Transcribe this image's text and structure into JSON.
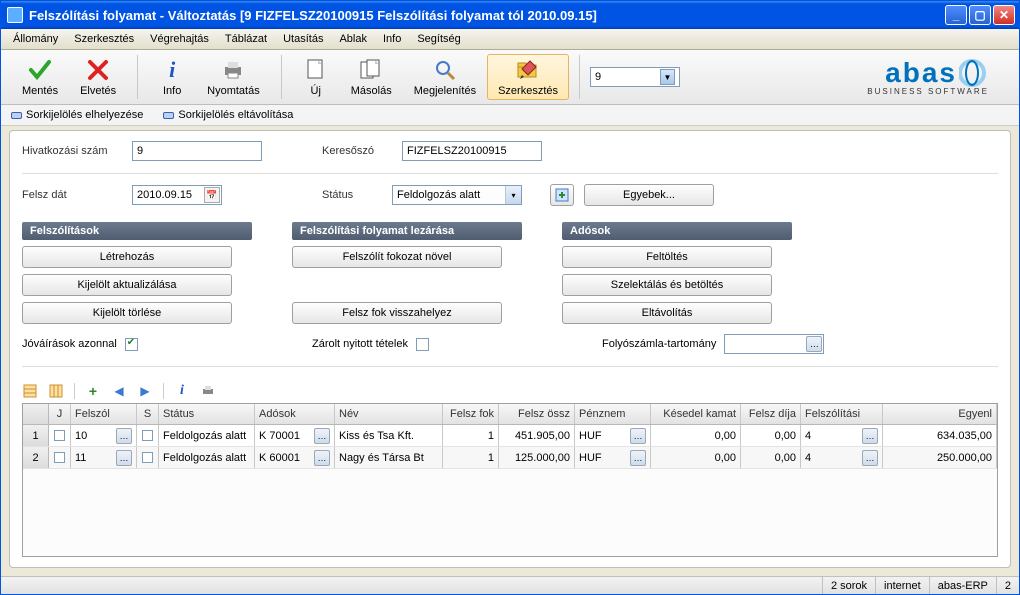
{
  "window": {
    "title": "Felszólítási folyamat - Változtatás  [9   FIZFELSZ20100915   Felszólítási folyamat tól 2010.09.15]"
  },
  "menu": [
    "Állomány",
    "Szerkesztés",
    "Végrehajtás",
    "Táblázat",
    "Utasítás",
    "Ablak",
    "Info",
    "Segítség"
  ],
  "toolbar": {
    "mentes": "Mentés",
    "elvetes": "Elvetés",
    "info": "Info",
    "nyomtatas": "Nyomtatás",
    "uj": "Új",
    "masolas": "Másolás",
    "megjelenites": "Megjelenítés",
    "szerkesztes": "Szerkesztés",
    "combo_value": "9"
  },
  "logo": {
    "big": "abas",
    "small": "BUSINESS SOFTWARE"
  },
  "subbar": {
    "a": "Sorkijelölés elhelyezése",
    "b": "Sorkijelölés eltávolítása"
  },
  "form": {
    "hivsz_label": "Hivatkozási szám",
    "hivsz_value": "9",
    "keresoszo_label": "Keresőszó",
    "keresoszo_value": "FIZFELSZ20100915",
    "felsz_dat_label": "Felsz dát",
    "felsz_dat_value": "2010.09.15",
    "status_label": "Státus",
    "status_value": "Feldolgozás alatt",
    "egyebek": "Egyebek...",
    "group1": "Felszólítások",
    "g1_b1": "Létrehozás",
    "g1_b2": "Kijelölt aktualizálása",
    "g1_b3": "Kijelölt törlése",
    "group2": "Felszólítási folyamat lezárása",
    "g2_b1": "Felszólít fokozat növel",
    "g2_b2": "Felsz fok visszahelyez",
    "group3": "Adósok",
    "g3_b1": "Feltöltés",
    "g3_b2": "Szelektálás és betöltés",
    "g3_b3": "Eltávolítás",
    "jov_label": "Jóváírások azonnal",
    "zarolt_label": "Zárolt nyitott tételek",
    "folyo_label": "Folyószámla-tartomány"
  },
  "grid": {
    "cols": {
      "rownum": "",
      "j": "J",
      "felszol": "Felszól",
      "s": "S",
      "status": "Státus",
      "adosok": "Adósok",
      "nev": "Név",
      "felszfok": "Felsz fok",
      "felszossz": "Felsz össz",
      "penznem": "Pénznem",
      "kesedel": "Késedel kamat",
      "felszdija": "Felsz díja",
      "felszolitasi": "Felszólítási",
      "egyenl": "Egyenl"
    },
    "rows": [
      {
        "n": "1",
        "j": false,
        "felszol": "10",
        "s": "",
        "status": "Feldolgozás alatt",
        "adosok": "K 70001",
        "nev": "Kiss és Tsa Kft.",
        "felszfok": "1",
        "felszossz": "451.905,00",
        "penznem": "HUF",
        "kesedel": "0,00",
        "felszdija": "0,00",
        "felszolitasi": "4",
        "egyenl": "634.035,00"
      },
      {
        "n": "2",
        "j": false,
        "felszol": "11",
        "s": "",
        "status": "Feldolgozás alatt",
        "adosok": "K 60001",
        "nev": "Nagy és Társa Bt",
        "felszfok": "1",
        "felszossz": "125.000,00",
        "penznem": "HUF",
        "kesedel": "0,00",
        "felszdija": "0,00",
        "felszolitasi": "4",
        "egyenl": "250.000,00"
      }
    ]
  },
  "statusbar": {
    "sorok": "2 sorok",
    "internet": "internet",
    "erp": "abas-ERP",
    "page": "2"
  }
}
